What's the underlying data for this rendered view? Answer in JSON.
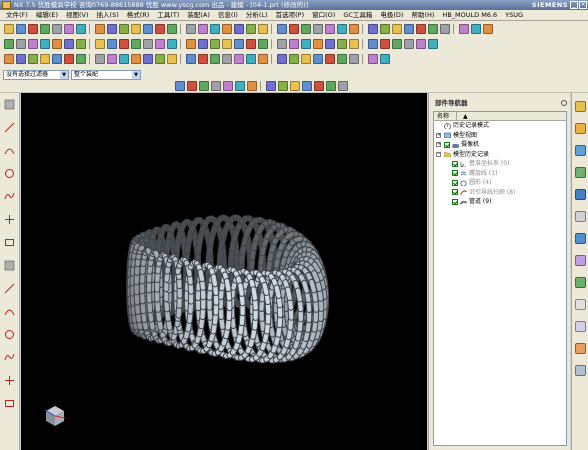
{
  "titlebar": {
    "title": "NX 7.5 优胜模具学校 咨询0769-88615888 优胜 www.yscg.com 出品 - 建模 - [04-1.prt (修改的)]",
    "brand": "SIEMENS",
    "minimize": "_",
    "close": "×"
  },
  "menubar": {
    "items": [
      "文件(F)",
      "编辑(E)",
      "视图(V)",
      "插入(S)",
      "格式(R)",
      "工具(T)",
      "装配(A)",
      "信息(I)",
      "分析(L)",
      "首选项(P)",
      "窗口(O)",
      "GC工具箱",
      "电极(D)",
      "帮助(H)",
      "HB_MOULD M6.6",
      "YSUG"
    ]
  },
  "filters": {
    "selection_filter": "没有选择过滤器",
    "assembly_scope": "整个装配",
    "dropdown_arrow": "▼"
  },
  "navigator": {
    "title": "部件导航器",
    "column_name": "名称",
    "sort_marker": "▲",
    "collapsed_marker": "+",
    "expanded_marker": "−",
    "tree": {
      "history_mode": "历史记录模式",
      "model_views": "模型视图",
      "cameras": "摄像机",
      "model_history": "模型历史记录",
      "features": [
        {
          "label": "基准坐标系 (0)",
          "greyed": true
        },
        {
          "label": "螺旋线 (1)",
          "greyed": true
        },
        {
          "label": "圆形 (4)",
          "greyed": true
        },
        {
          "label": "沿引导线扫掠 (8)",
          "greyed": true
        },
        {
          "label": "管道 (9)",
          "greyed": false
        }
      ]
    }
  },
  "colors": {
    "viewport_background": "#000000",
    "spring_color": "#d7dee6",
    "chrome": "#ece9d8"
  },
  "icons": {
    "toolbar": [
      "new-icon",
      "open-icon",
      "save-icon",
      "cut-icon",
      "copy-icon",
      "paste-icon",
      "undo-icon",
      "redo-icon",
      "start-icon",
      "fit-view-icon",
      "zoom-icon",
      "rotate-icon",
      "pan-icon",
      "shaded-icon",
      "sketch-icon",
      "extrude-icon",
      "revolve-icon",
      "hole-icon",
      "blend-icon",
      "chamfer-icon",
      "shell-icon",
      "trim-icon",
      "datum-plane-icon",
      "datum-csys-icon",
      "measure-icon",
      "layer-icon"
    ],
    "left_toolbar": [
      "select-icon",
      "line-icon",
      "arc-icon",
      "circle-icon",
      "spline-icon",
      "point-icon",
      "rectangle-icon",
      "polygon-icon",
      "offset-icon",
      "trim-curve-icon",
      "extend-curve-icon",
      "helix-icon",
      "text-icon",
      "dimension-icon"
    ],
    "resource_bar": [
      "assembly-navigator-icon",
      "part-navigator-icon",
      "reuse-library-icon",
      "hd3d-tools-icon",
      "web-browser-icon",
      "history-icon",
      "system-materials-icon",
      "process-studio-icon",
      "manufacturing-wizards-icon",
      "roles-icon",
      "system-scenes-icon",
      "palette-icon",
      "document-icon"
    ]
  }
}
